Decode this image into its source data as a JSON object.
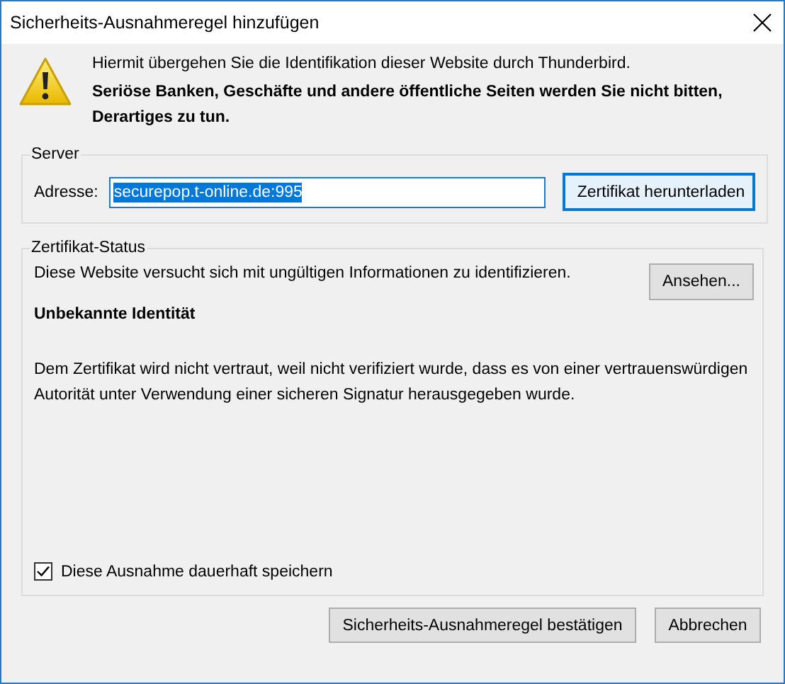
{
  "window": {
    "title": "Sicherheits-Ausnahmeregel hinzufügen"
  },
  "warning": {
    "line_1": "Hiermit übergehen Sie die Identifikation dieser Website durch Thunderbird.",
    "line_2": "Seriöse Banken, Geschäfte und andere öffentliche Seiten werden Sie nicht bitten, Derartiges zu tun."
  },
  "server": {
    "legend": "Server",
    "address_label": "Adresse:",
    "address_value": "securepop.t-online.de:995",
    "address_selected": true,
    "download_button": "Zertifikat herunterladen"
  },
  "certificate_status": {
    "legend": "Zertifikat-Status",
    "message": "Diese Website versucht sich mit ungültigen Informationen zu identifizieren.",
    "view_button": "Ansehen...",
    "heading": "Unbekannte Identität",
    "details": "Dem Zertifikat wird nicht vertraut, weil nicht verifiziert wurde, dass es von einer vertrauenswürdigen Autorität unter Verwendung einer sicheren Signatur herausgegeben wurde."
  },
  "permanent": {
    "label": "Diese Ausnahme dauerhaft speichern",
    "checked": true
  },
  "buttons": [
    {
      "label": "Sicherheits-Ausnahmeregel bestätigen",
      "kind": "confirm"
    },
    {
      "label": "Abbrechen",
      "kind": "cancel"
    }
  ]
}
